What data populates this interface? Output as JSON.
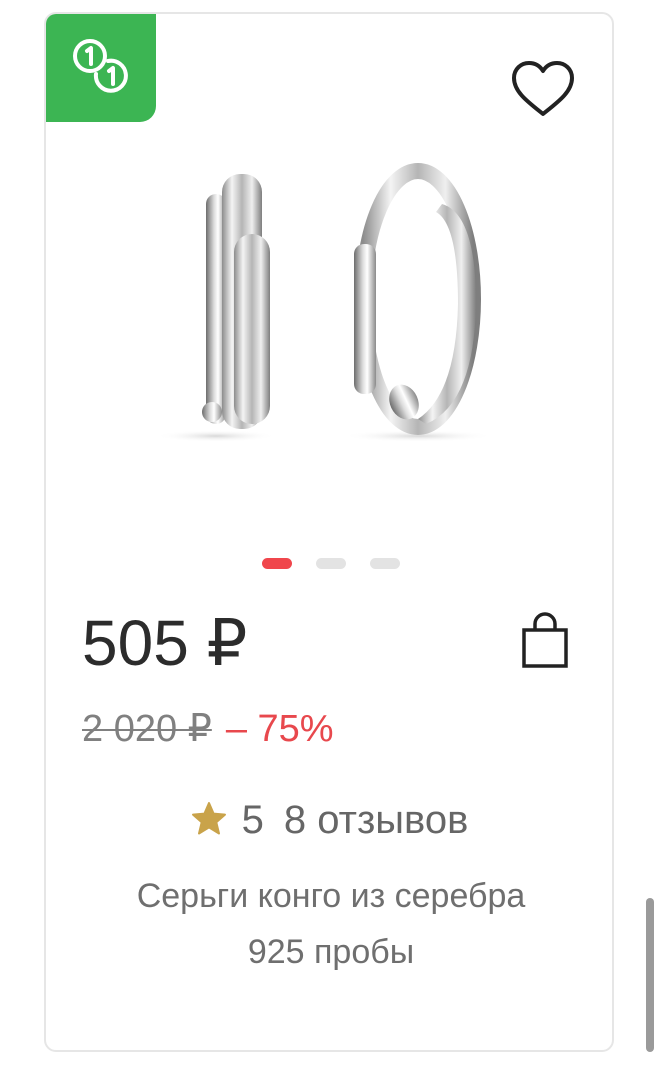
{
  "badge": {
    "icon": "coins-cashback-icon",
    "color": "#3cb553"
  },
  "favorite": {
    "icon": "heart-outline-icon"
  },
  "gallery": {
    "image": "silver-hoop-earrings",
    "dots": [
      {
        "active": true
      },
      {
        "active": false
      },
      {
        "active": false
      }
    ],
    "active_color": "#f0464c"
  },
  "price": {
    "current": "505 ₽",
    "old": "2 020 ₽",
    "discount": "– 75%"
  },
  "cart": {
    "icon": "shopping-bag-icon"
  },
  "rating": {
    "icon": "star-icon",
    "value": "5",
    "reviews": "8 отзывов",
    "star_color": "#c9a34a"
  },
  "product": {
    "title": "Серьги конго из серебра 925 пробы"
  }
}
